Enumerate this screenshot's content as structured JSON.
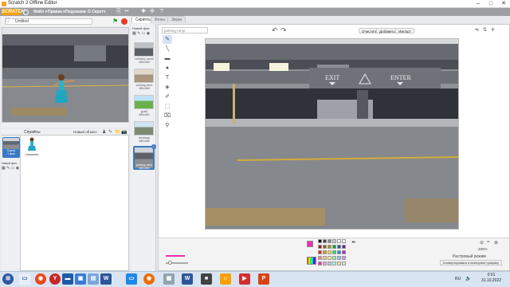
{
  "window": {
    "title": "Scratch 2 Offline Editor",
    "controls": {
      "minimize": "–",
      "maximize": "□",
      "close": "✕"
    }
  },
  "menubar": {
    "logo": "SCRATCH",
    "items": [
      "Файл ▾",
      "Правка ▾",
      "Подсказки",
      "О Скретч"
    ]
  },
  "stage_header": {
    "project_name": "Untitled"
  },
  "sprites_header": {
    "title": "Спрайты",
    "new_sprite": "Новый объект:"
  },
  "stage_panel": {
    "label": "Сцена\n1 фон",
    "new_backdrop": "Новый фон:"
  },
  "sprite_list": [
    {
      "name": "Cassandra"
    }
  ],
  "tabs": {
    "scripts": "Скрипты",
    "backdrops": "Фоны",
    "sounds": "Звуки"
  },
  "backdrop_sidebar": {
    "header": "Новый фон:",
    "items": [
      {
        "index": "1",
        "name": "berkeley mural",
        "size": "480x360"
      },
      {
        "index": "2",
        "name": "clothing store",
        "size": "480x360"
      },
      {
        "index": "3",
        "name": "goal2",
        "size": "480x360"
      },
      {
        "index": "4",
        "name": "driveway",
        "size": "480x360"
      },
      {
        "index": "5",
        "name": "parking-ramp",
        "size": "480x360"
      }
    ]
  },
  "editor": {
    "costume_name": "parking-ramp",
    "buttons": {
      "clear": "Очистить",
      "add": "Добавить",
      "import": "Импорт"
    },
    "canvas_signs": {
      "exit": "EXIT",
      "enter": "ENTER"
    },
    "zoom": "200%",
    "mode": "Растровый режим",
    "convert": "Конвертировать в векторное графику"
  },
  "colors": {
    "current": "#ec2fb9",
    "accent": "#f7a000",
    "menubar": "#9c9ea2"
  },
  "taskbar": {
    "lang": "RU",
    "time": "0:01",
    "date": "31.10.2022"
  }
}
